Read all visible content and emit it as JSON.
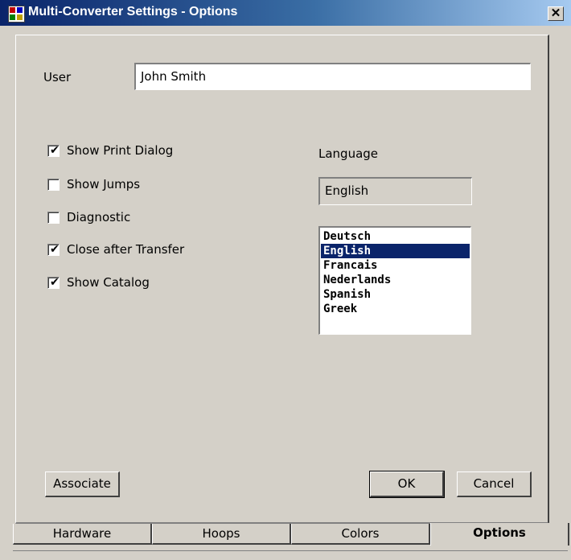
{
  "window": {
    "title": "Multi-Converter Settings - Options",
    "close_glyph": "✕"
  },
  "user": {
    "label": "User",
    "value": "John Smith"
  },
  "checkboxes": [
    {
      "label": "Show Print Dialog",
      "checked": true
    },
    {
      "label": "Show Jumps",
      "checked": false
    },
    {
      "label": "Diagnostic",
      "checked": false
    },
    {
      "label": "Close after Transfer",
      "checked": true
    },
    {
      "label": "Show Catalog",
      "checked": true
    }
  ],
  "language": {
    "label": "Language",
    "current": "English",
    "options": [
      "Deutsch",
      "English",
      "Francais",
      "Nederlands",
      "Spanish",
      "Greek"
    ],
    "selected": "English"
  },
  "buttons": {
    "associate": "Associate",
    "ok": "OK",
    "cancel": "Cancel"
  },
  "tabs": [
    {
      "label": "Hardware",
      "active": false
    },
    {
      "label": "Hoops",
      "active": false
    },
    {
      "label": "Colors",
      "active": false
    },
    {
      "label": "Options",
      "active": true
    }
  ],
  "colors": {
    "titlebar": "#0a246a",
    "face": "#d4d0c8",
    "selection": "#0a246a"
  }
}
